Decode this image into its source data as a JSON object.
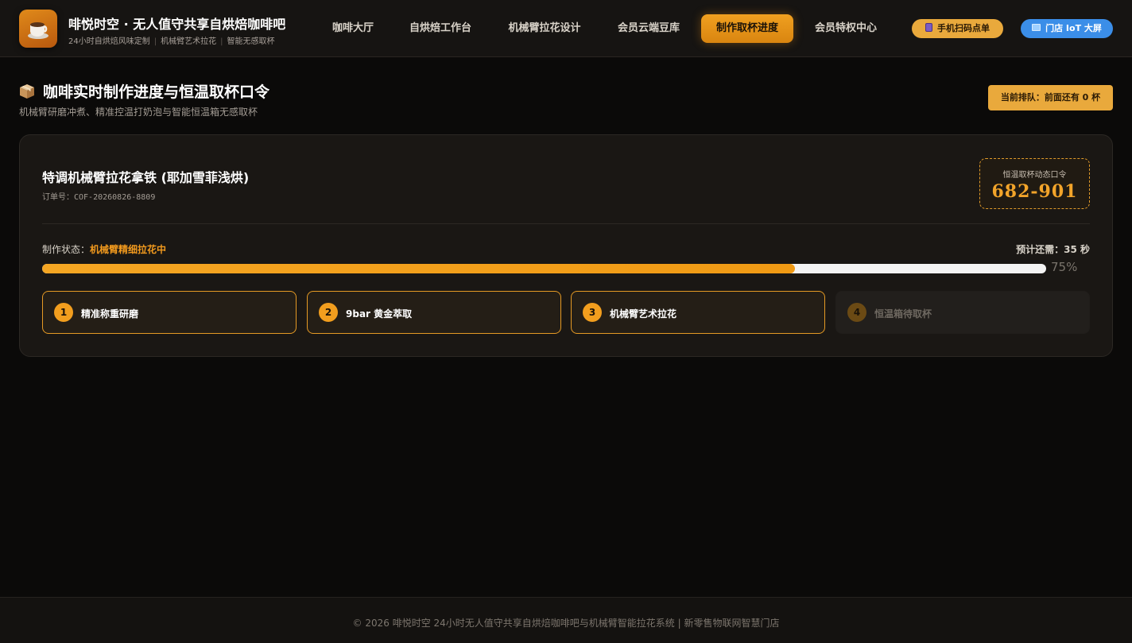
{
  "header": {
    "brand_title": "啡悦时空 · 无人值守共享自烘焙咖啡吧",
    "brand_tags": [
      "24小时自烘焙风味定制",
      "机械臂艺术拉花",
      "智能无感取杯"
    ],
    "nav": [
      {
        "label": "咖啡大厅",
        "active": false
      },
      {
        "label": "自烘焙工作台",
        "active": false
      },
      {
        "label": "机械臂拉花设计",
        "active": false
      },
      {
        "label": "会员云端豆库",
        "active": false
      },
      {
        "label": "制作取杯进度",
        "active": true
      },
      {
        "label": "会员特权中心",
        "active": false
      }
    ],
    "scan_order_label": "手机扫码点单",
    "store_iot_label": "门店 IoT 大屏"
  },
  "page": {
    "title": "咖啡实时制作进度与恒温取杯口令",
    "subtitle": "机械臂研磨冲煮、精准控温打奶泡与智能恒温箱无感取杯",
    "queue_badge": "当前排队：前面还有 0 杯"
  },
  "order": {
    "name": "特调机械臂拉花拿铁 (耶加雪菲浅烘)",
    "id_label": "订单号：",
    "id_value": "COF-20260826-8809",
    "code_label": "恒温取杯动态口令",
    "code_value": "682-901",
    "status_label": "制作状态：",
    "status_value": "机械臂精细拉花中",
    "eta": "预计还需：35 秒",
    "progress_percent": 75,
    "progress_text": "75%",
    "steps": [
      {
        "num": "1",
        "label": "精准称重研磨",
        "done": true
      },
      {
        "num": "2",
        "label": "9bar 黄金萃取",
        "done": true
      },
      {
        "num": "3",
        "label": "机械臂艺术拉花",
        "done": true
      },
      {
        "num": "4",
        "label": "恒温箱待取杯",
        "done": false
      }
    ]
  },
  "footer": {
    "text": "© 2026 啡悦时空 24小时无人值守共享自烘焙咖啡吧与机械臂智能拉花系统 | 新零售物联网智慧门店"
  },
  "colors": {
    "accent": "#f29e1e",
    "iot_blue": "#3b8ee8",
    "background": "#0b0a09"
  },
  "icons": {
    "logo": "coffee-cup-icon",
    "scan": "phone-icon",
    "iot": "monitor-icon",
    "title": "package-box-icon"
  }
}
